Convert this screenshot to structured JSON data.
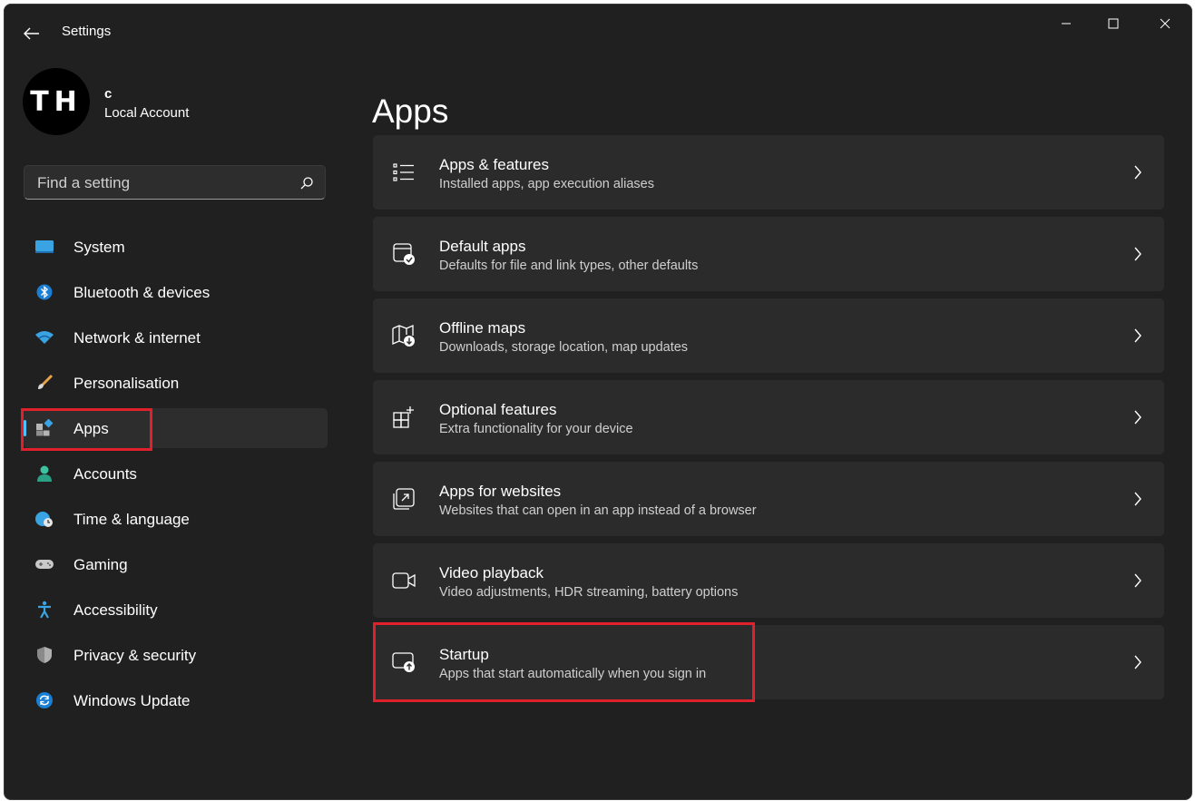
{
  "window": {
    "title": "Settings"
  },
  "profile": {
    "avatar_text": "TH",
    "name": "c",
    "account_type": "Local Account"
  },
  "search": {
    "placeholder": "Find a setting",
    "value": ""
  },
  "nav": {
    "items": [
      {
        "label": "System",
        "icon": "monitor-icon"
      },
      {
        "label": "Bluetooth & devices",
        "icon": "bluetooth-icon"
      },
      {
        "label": "Network & internet",
        "icon": "wifi-icon"
      },
      {
        "label": "Personalisation",
        "icon": "brush-icon"
      },
      {
        "label": "Apps",
        "icon": "apps-icon",
        "selected": true
      },
      {
        "label": "Accounts",
        "icon": "person-icon"
      },
      {
        "label": "Time & language",
        "icon": "globe-clock-icon"
      },
      {
        "label": "Gaming",
        "icon": "gamepad-icon"
      },
      {
        "label": "Accessibility",
        "icon": "accessibility-icon"
      },
      {
        "label": "Privacy & security",
        "icon": "shield-icon"
      },
      {
        "label": "Windows Update",
        "icon": "sync-icon"
      }
    ]
  },
  "page": {
    "title": "Apps",
    "cards": [
      {
        "title": "Apps & features",
        "subtitle": "Installed apps, app execution aliases",
        "icon": "list-icon"
      },
      {
        "title": "Default apps",
        "subtitle": "Defaults for file and link types, other defaults",
        "icon": "default-apps-icon"
      },
      {
        "title": "Offline maps",
        "subtitle": "Downloads, storage location, map updates",
        "icon": "map-download-icon"
      },
      {
        "title": "Optional features",
        "subtitle": "Extra functionality for your device",
        "icon": "grid-plus-icon"
      },
      {
        "title": "Apps for websites",
        "subtitle": "Websites that can open in an app instead of a browser",
        "icon": "open-external-icon"
      },
      {
        "title": "Video playback",
        "subtitle": "Video adjustments, HDR streaming, battery options",
        "icon": "video-camera-icon"
      },
      {
        "title": "Startup",
        "subtitle": "Apps that start automatically when you sign in",
        "icon": "startup-icon"
      }
    ]
  },
  "colors": {
    "background": "#202020",
    "card": "#2b2b2b",
    "accent": "#4cc2ff",
    "highlight": "#e0202a"
  }
}
